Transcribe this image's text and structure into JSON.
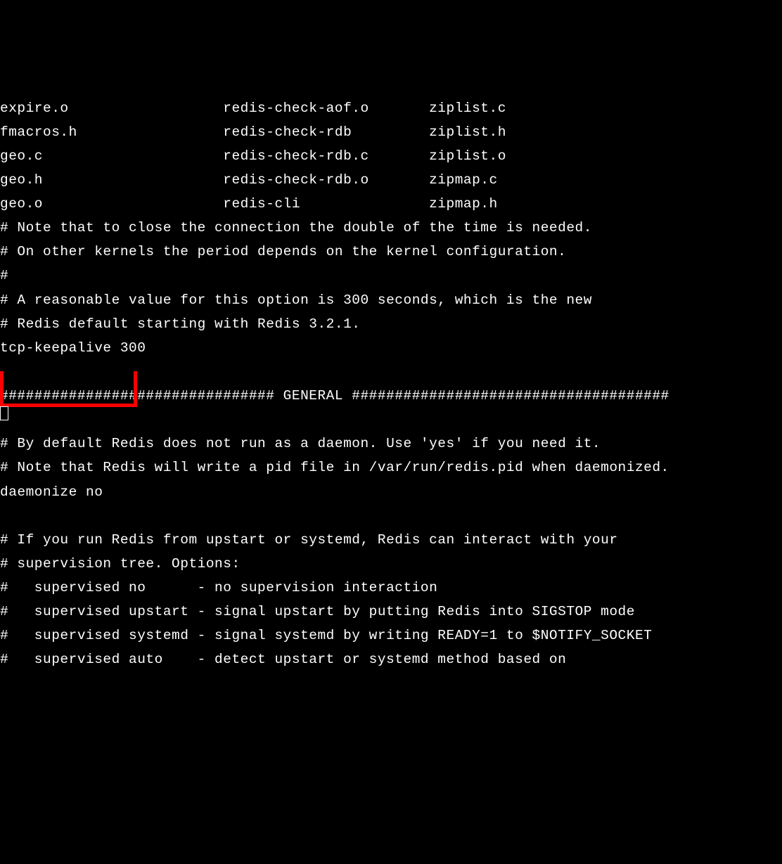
{
  "lines": [
    "expire.o                  redis-check-aof.o       ziplist.c",
    "fmacros.h                 redis-check-rdb         ziplist.h",
    "geo.c                     redis-check-rdb.c       ziplist.o",
    "geo.h                     redis-check-rdb.o       zipmap.c",
    "geo.o                     redis-cli               zipmap.h",
    "# Note that to close the connection the double of the time is needed.",
    "# On other kernels the period depends on the kernel configuration.",
    "#",
    "# A reasonable value for this option is 300 seconds, which is the new",
    "# Redis default starting with Redis 3.2.1.",
    "tcp-keepalive 300",
    "",
    "################################ GENERAL #####################################",
    "",
    "# By default Redis does not run as a daemon. Use 'yes' if you need it.",
    "# Note that Redis will write a pid file in /var/run/redis.pid when daemonized.",
    "daemonize no",
    "",
    "# If you run Redis from upstart or systemd, Redis can interact with your",
    "# supervision tree. Options:",
    "#   supervised no      - no supervision interaction",
    "#   supervised upstart - signal upstart by putting Redis into SIGSTOP mode",
    "#   supervised systemd - signal systemd by writing READY=1 to $NOTIFY_SOCKET",
    "#   supervised auto    - detect upstart or systemd method based on"
  ]
}
